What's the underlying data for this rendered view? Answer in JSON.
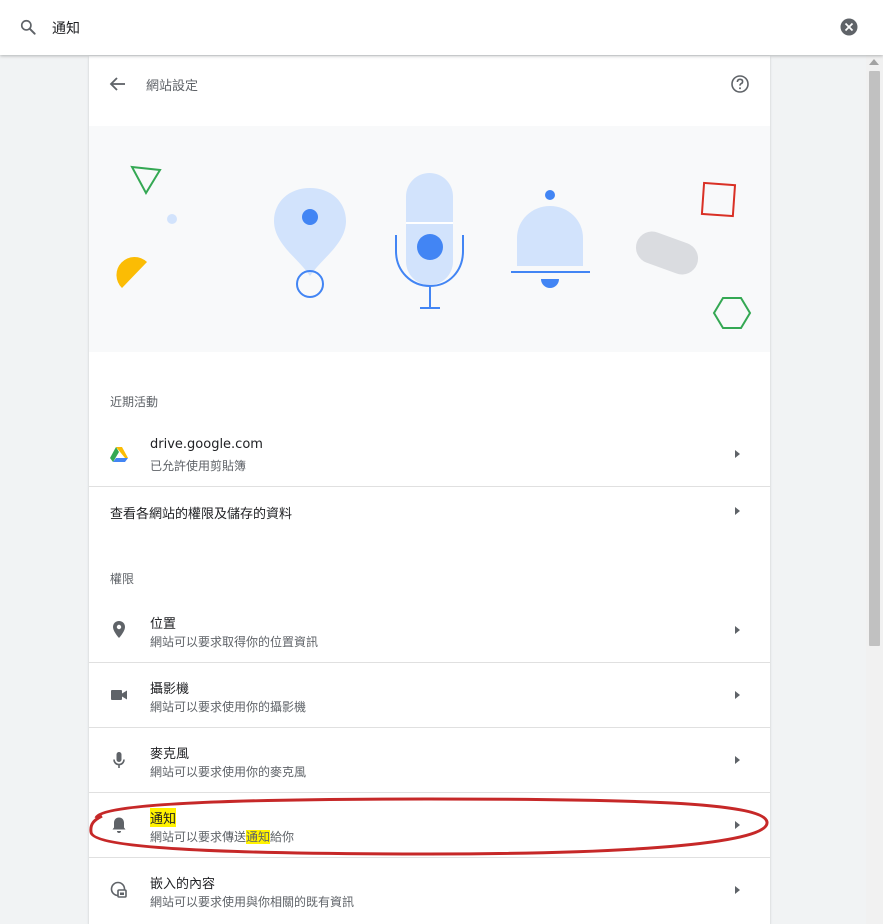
{
  "search": {
    "query": "通知"
  },
  "header": {
    "title": "網站設定"
  },
  "recent": {
    "label": "近期活動",
    "items": [
      {
        "title": "drive.google.com",
        "subtitle": "已允許使用剪貼簿",
        "icon": "google-drive-icon"
      }
    ]
  },
  "all_sites": {
    "label": "查看各網站的權限及儲存的資料"
  },
  "permissions": {
    "label": "權限",
    "items": [
      {
        "title": "位置",
        "subtitle": "網站可以要求取得你的位置資訊",
        "icon": "location-pin-icon"
      },
      {
        "title": "攝影機",
        "subtitle": "網站可以要求使用你的攝影機",
        "icon": "camera-icon"
      },
      {
        "title": "麥克風",
        "subtitle": "網站可以要求使用你的麥克風",
        "icon": "microphone-icon"
      },
      {
        "title": "通知",
        "subtitle_before": "網站可以要求傳送",
        "subtitle_highlight": "通知",
        "subtitle_after": "給你",
        "icon": "bell-icon"
      },
      {
        "title": "嵌入的內容",
        "subtitle": "網站可以要求使用與你相關的既有資訊",
        "icon": "embedded-content-icon"
      }
    ]
  },
  "colors": {
    "accent_blue": "#4285f4",
    "annotation_red": "#c62828",
    "highlight_yellow": "#fff200"
  }
}
